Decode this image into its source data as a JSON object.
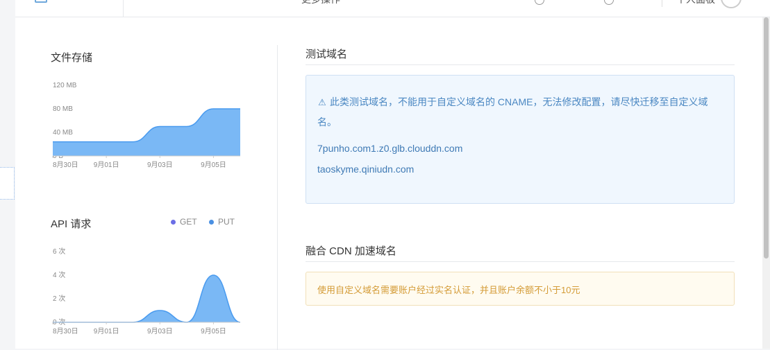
{
  "topbar": {
    "more_ops": "更多操作",
    "user_center": "个人面板",
    "icon1": "gear-icon",
    "icon2": "bell-icon"
  },
  "storage": {
    "title": "文件存储",
    "chart_data": {
      "type": "area",
      "title": "文件存储",
      "y_ticks": [
        "120 MB",
        "80 MB",
        "40 MB",
        "0 B"
      ],
      "ylim": [
        0,
        120
      ],
      "x_ticks": [
        "8月30日",
        "9月01日",
        "9月03日",
        "9月05日"
      ],
      "series": [
        {
          "x": [
            "8月30日",
            "8月31日",
            "9月01日",
            "9月02日",
            "9月03日",
            "9月04日",
            "9月05日",
            "9月06日"
          ],
          "values": [
            24,
            24,
            24,
            24,
            50,
            50,
            80,
            80
          ],
          "color": "#7ab8f5"
        }
      ],
      "grid": false
    }
  },
  "api": {
    "title": "API 请求",
    "legend": [
      {
        "label": "GET",
        "color": "#6b6ee6"
      },
      {
        "label": "PUT",
        "color": "#4a90e2"
      }
    ],
    "chart_data": {
      "type": "area",
      "title": "API 请求",
      "y_ticks": [
        "6 次",
        "4 次",
        "2 次",
        "0 次"
      ],
      "ylim": [
        0,
        6
      ],
      "x_ticks": [
        "8月30日",
        "9月01日",
        "9月03日",
        "9月05日"
      ],
      "series": [
        {
          "name": "PUT",
          "x": [
            "8月30日",
            "8月31日",
            "9月01日",
            "9月02日",
            "9月03日",
            "9月04日",
            "9月05日",
            "9月06日"
          ],
          "values": [
            0,
            0,
            0,
            0,
            1,
            0,
            4,
            0
          ],
          "color": "#7ab8f5"
        },
        {
          "name": "GET",
          "values": [
            0,
            0,
            0,
            0,
            0,
            0,
            0,
            0
          ],
          "color": "#6b6ee6"
        }
      ],
      "grid": false
    }
  },
  "test_domain": {
    "title": "测试域名",
    "warning": "此类测试域名，不能用于自定义域名的 CNAME，无法修改配置，请尽快迁移至自定义域名。",
    "warn_icon": "warning-icon",
    "domains": [
      "7punho.com1.z0.glb.clouddn.com",
      "taoskyme.qiniudn.com"
    ]
  },
  "cdn_domain": {
    "title": "融合 CDN 加速域名",
    "notice": "使用自定义域名需要账户经过实名认证，并且账户余额不小于10元"
  }
}
